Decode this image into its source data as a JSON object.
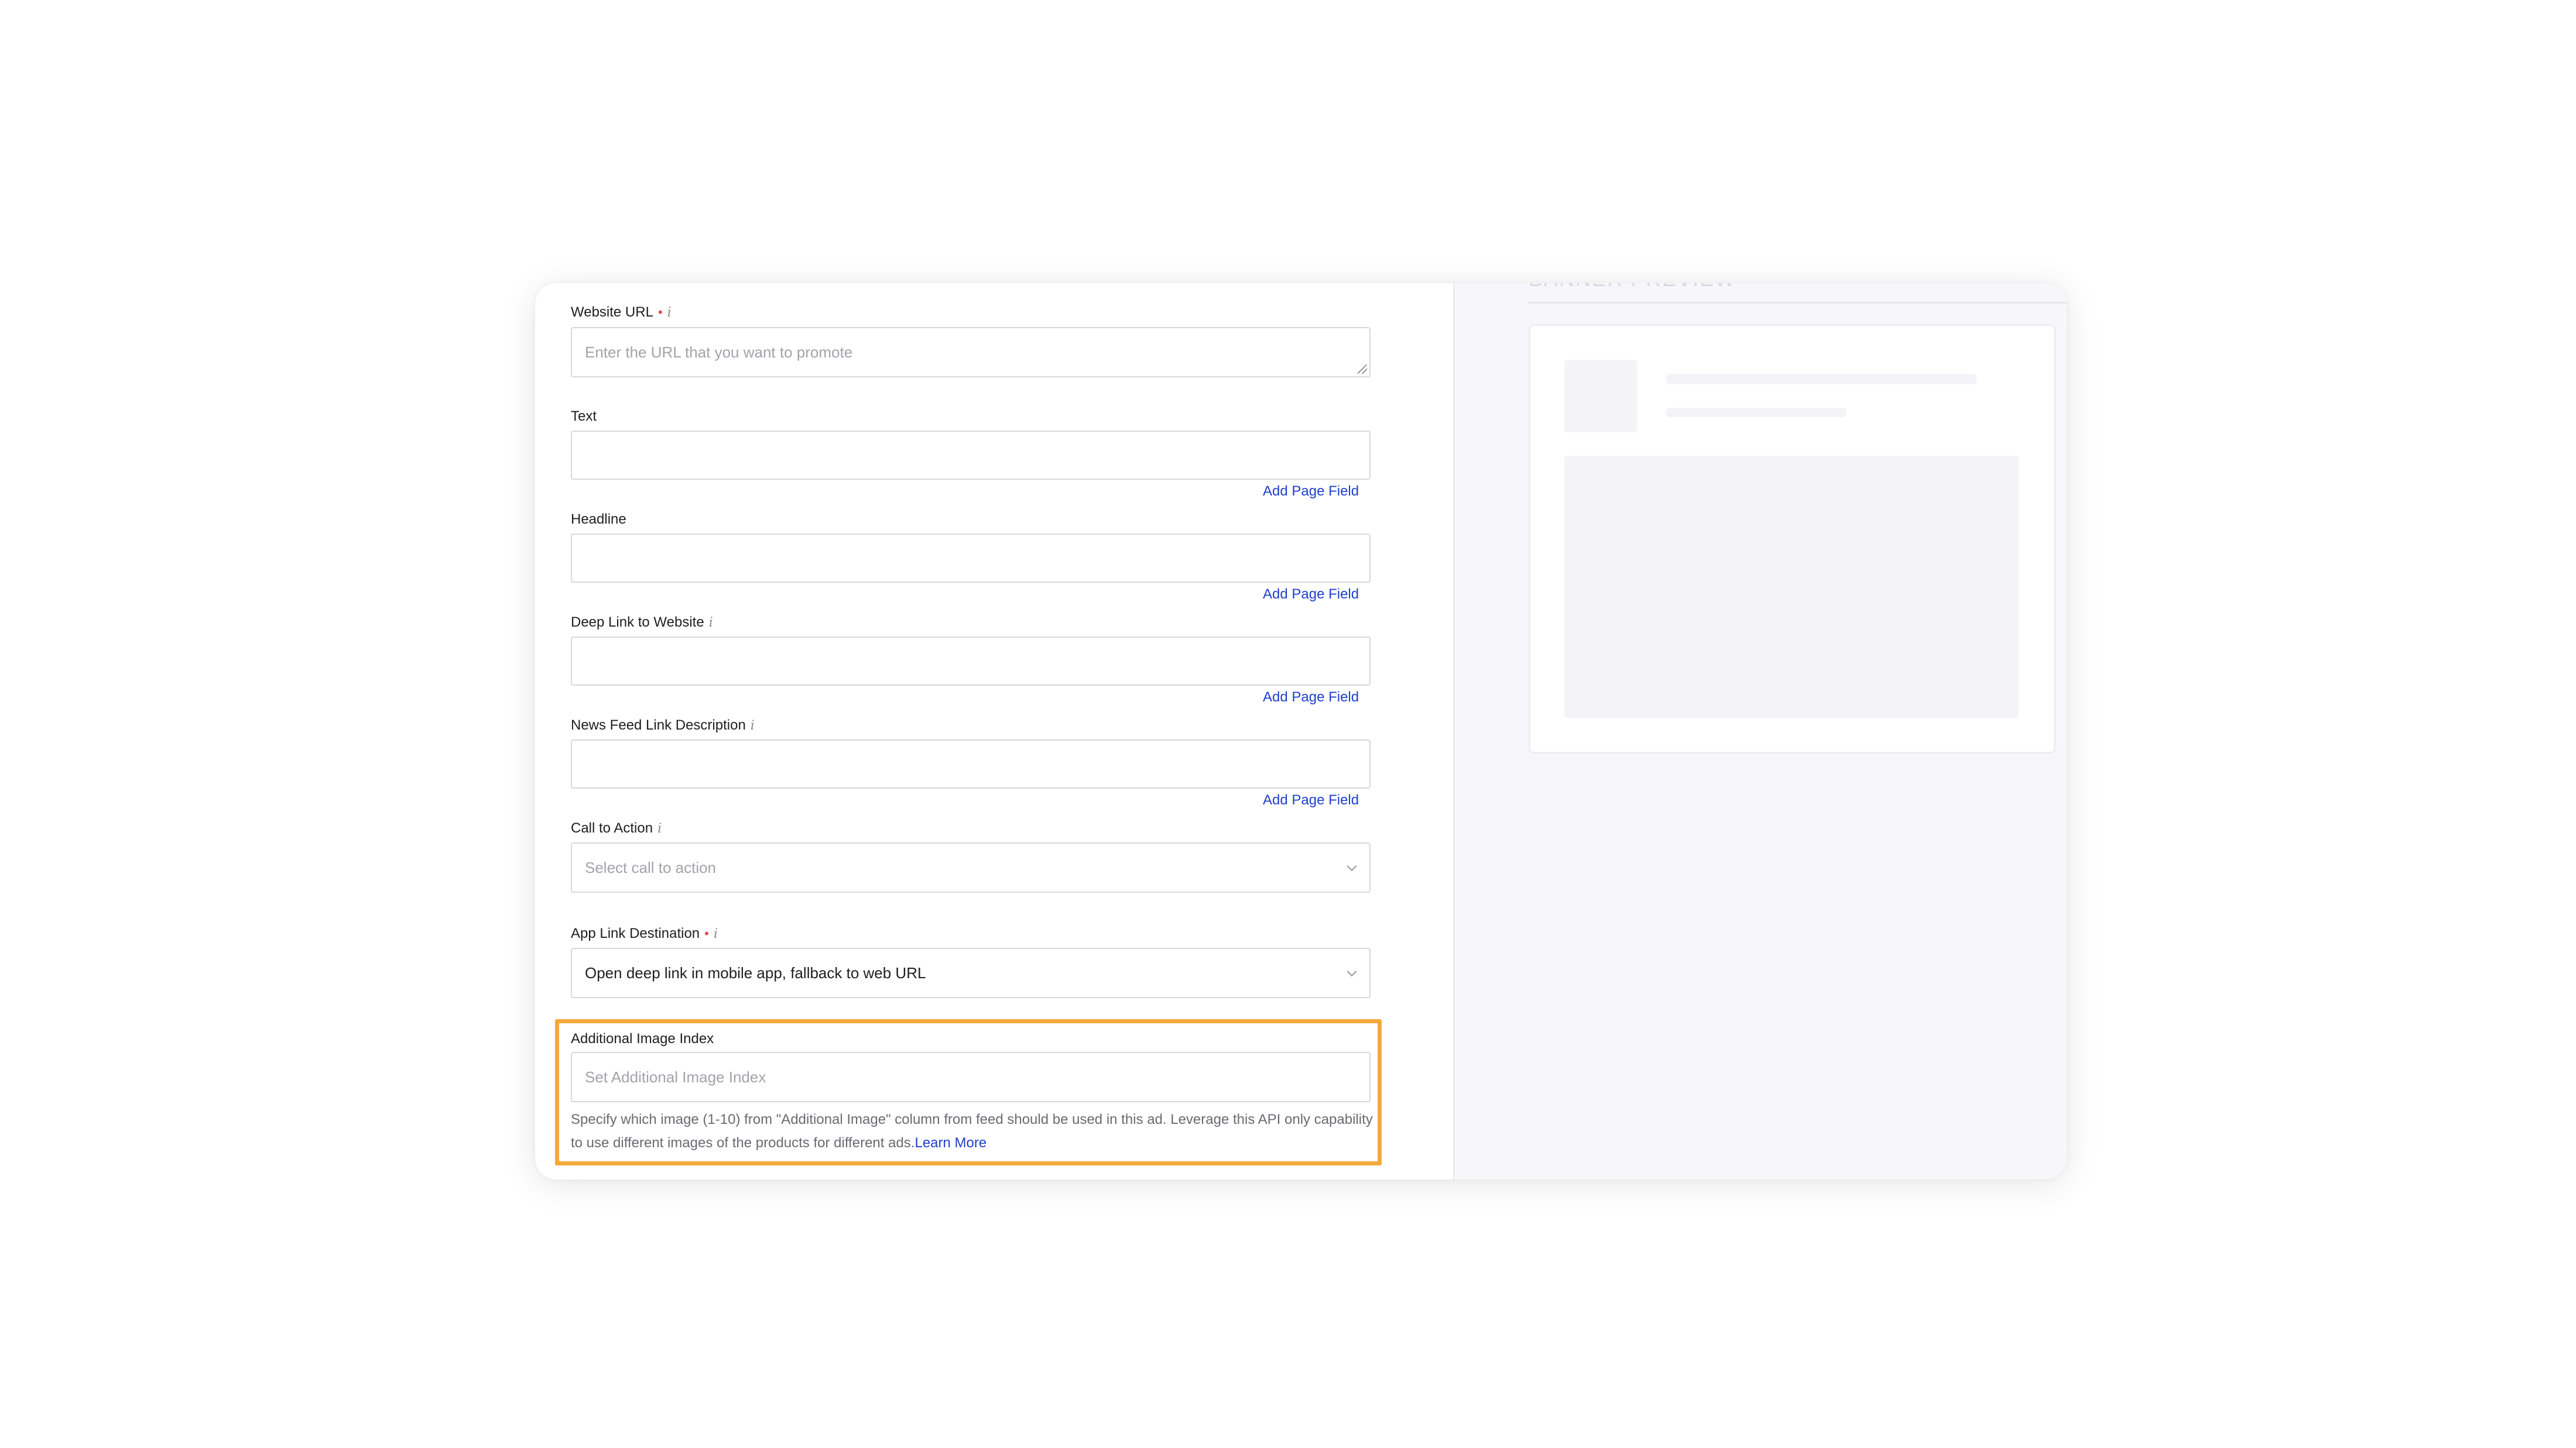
{
  "form": {
    "website_url": {
      "label": "Website URL",
      "placeholder": "Enter the URL that you want to promote"
    },
    "text": {
      "label": "Text",
      "add_link": "Add Page Field"
    },
    "headline": {
      "label": "Headline",
      "add_link": "Add Page Field"
    },
    "deep_link": {
      "label": "Deep Link to Website",
      "add_link": "Add Page Field"
    },
    "news_feed": {
      "label": "News Feed Link Description",
      "add_link": "Add Page Field"
    },
    "cta": {
      "label": "Call to Action",
      "placeholder": "Select call to action"
    },
    "app_link": {
      "label": "App Link Destination",
      "value": "Open deep link in mobile app, fallback to web URL"
    },
    "additional_image": {
      "label": "Additional Image Index",
      "placeholder": "Set Additional Image Index",
      "help": "Specify which image (1-10) from \"Additional Image\" column from feed should be used in this ad. Leverage this API only capability to use different images of the products for different ads.",
      "learn_more": "Learn More"
    },
    "required_mark": "•",
    "info_glyph": "i"
  },
  "preview": {
    "title": "BANNER PREVIEW"
  },
  "colors": {
    "link": "#1f3fcc",
    "highlight": "#f4a93a",
    "required": "#e54848"
  }
}
